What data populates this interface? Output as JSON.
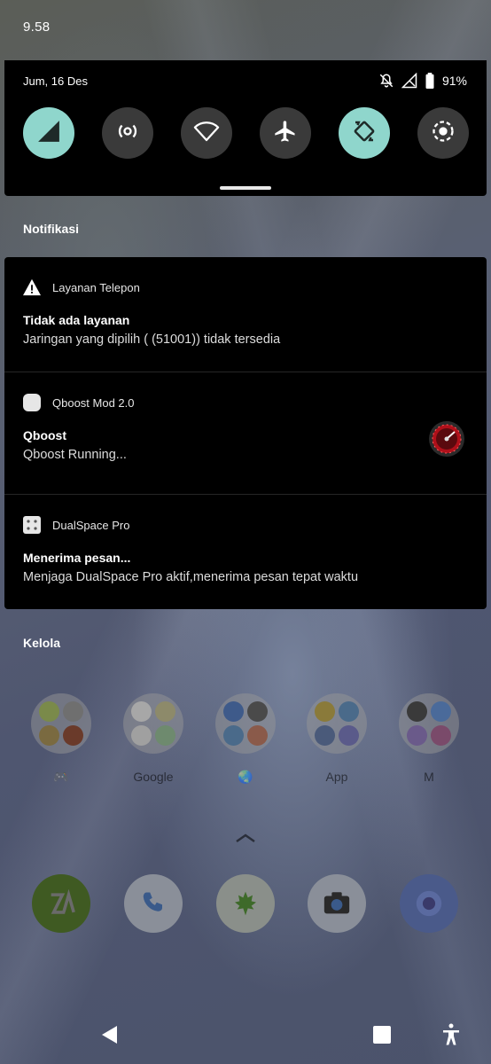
{
  "status_bar": {
    "time": "9.58"
  },
  "quick_settings": {
    "date": "Jum, 16 Des",
    "battery": "91%",
    "tiles": [
      {
        "name": "mobile-data",
        "active": true
      },
      {
        "name": "hotspot",
        "active": false
      },
      {
        "name": "wifi",
        "active": false
      },
      {
        "name": "airplane",
        "active": false
      },
      {
        "name": "auto-rotate",
        "active": true
      },
      {
        "name": "screen-record",
        "active": false
      }
    ]
  },
  "notifications_label": "Notifikasi",
  "notifications": [
    {
      "app": "Layanan Telepon",
      "icon": "warning-icon",
      "title": "Tidak ada layanan",
      "text": "Jaringan yang dipilih ( (51001)) tidak tersedia"
    },
    {
      "app": "Qboost Mod 2.0",
      "icon": "qboost-app-icon",
      "title": "Qboost",
      "text": "Qboost Running..."
    },
    {
      "app": "DualSpace Pro",
      "icon": "dualspace-app-icon",
      "title": "Menerima pesan...",
      "text": "Menjaga DualSpace Pro aktif,menerima pesan tepat waktu"
    }
  ],
  "manage_label": "Kelola",
  "home": {
    "folders": [
      {
        "label": "🎮"
      },
      {
        "label": "Google"
      },
      {
        "label": "🌏"
      },
      {
        "label": "App"
      },
      {
        "label": "M"
      }
    ],
    "dock": [
      "zarchiver-icon",
      "phone-icon",
      "leaf-app-icon",
      "camera-icon",
      "gallery-icon"
    ]
  },
  "colors": {
    "tile_active": "#8fd6cc",
    "tile_inactive": "#3a3a3a",
    "panel": "#000000"
  }
}
